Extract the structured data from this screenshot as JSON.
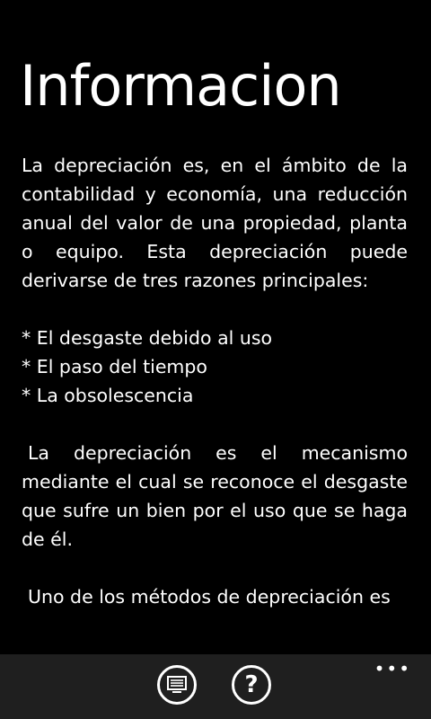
{
  "page": {
    "title": "Informacion"
  },
  "content": {
    "paragraph1": "La depreciación es, en el ámbito de la contabilidad y economía, una reducción anual del valor de una propiedad, planta o equipo. Esta depreciación puede derivarse de tres razones principales:",
    "bullets": [
      "* El desgaste debido al uso",
      "* El paso del tiempo",
      "* La obsolescencia"
    ],
    "paragraph2": "La depreciación es el mecanismo mediante el cual se reconoce el desgaste que sufre un bien por el uso que se haga de él.",
    "paragraph3": "Uno de los métodos de depreciación es"
  },
  "app_bar": {
    "buttons": [
      {
        "icon": "list-icon"
      },
      {
        "icon": "help-icon",
        "glyph": "?"
      }
    ],
    "more_label": "•••",
    "background": "#1f1f1f"
  },
  "colors": {
    "background": "#000000",
    "text": "#ffffff"
  }
}
